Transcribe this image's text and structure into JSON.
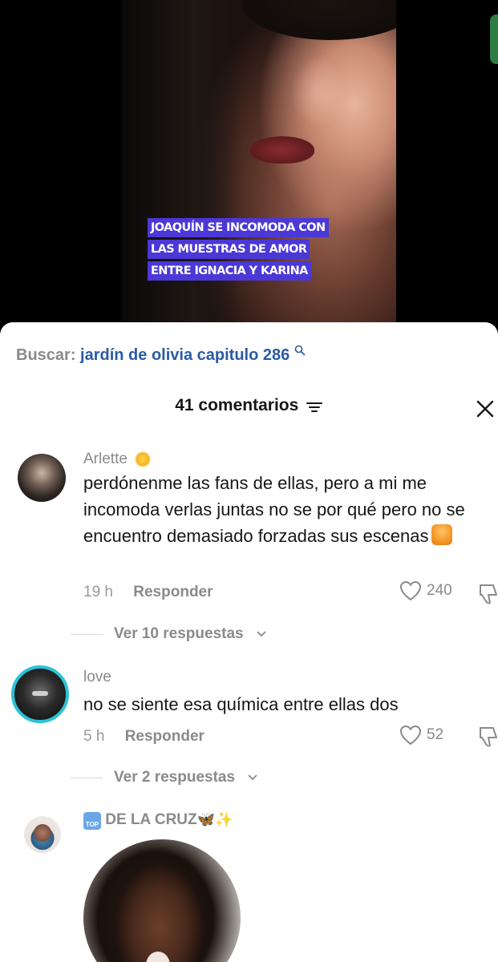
{
  "video": {
    "caption_lines": [
      "JOAQUÍN SE INCOMODA CON",
      "LAS MUESTRAS DE AMOR",
      "ENTRE IGNACIA Y KARINA"
    ],
    "caption_color": "#4b38d6"
  },
  "search": {
    "label": "Buscar:",
    "query": "jardín de olivia capitulo 286",
    "icon": "search-icon"
  },
  "comments_header": {
    "count_label": "41 comentarios",
    "filter_icon": "sort-lines-icon",
    "close_icon": "close-icon"
  },
  "comments": [
    {
      "username": "Arlette",
      "badge": "sun-emoji",
      "text": "perdónenme las fans de ellas, pero a mi me incomoda verlas juntas no se por qué pero no se encuentro demasiado forzadas sus escenas",
      "text_emoji": "person-shrugging-emoji",
      "time": "19 h",
      "reply_label": "Responder",
      "likes": "240",
      "replies_label": "Ver 10 respuestas"
    },
    {
      "username": "love",
      "text": "no se siente esa química entre ellas dos",
      "time": "5 h",
      "reply_label": "Responder",
      "likes": "52",
      "replies_label": "Ver 2 respuestas"
    },
    {
      "username": "DE LA CRUZ",
      "badge_top": "TOP",
      "trailing_emojis": [
        "butterfly-emoji",
        "sparkles-emoji"
      ]
    }
  ],
  "colors": {
    "accent_blue": "#2b5aa6",
    "story_ring": "#2bc3d6",
    "muted_text": "#8a8a8a"
  }
}
